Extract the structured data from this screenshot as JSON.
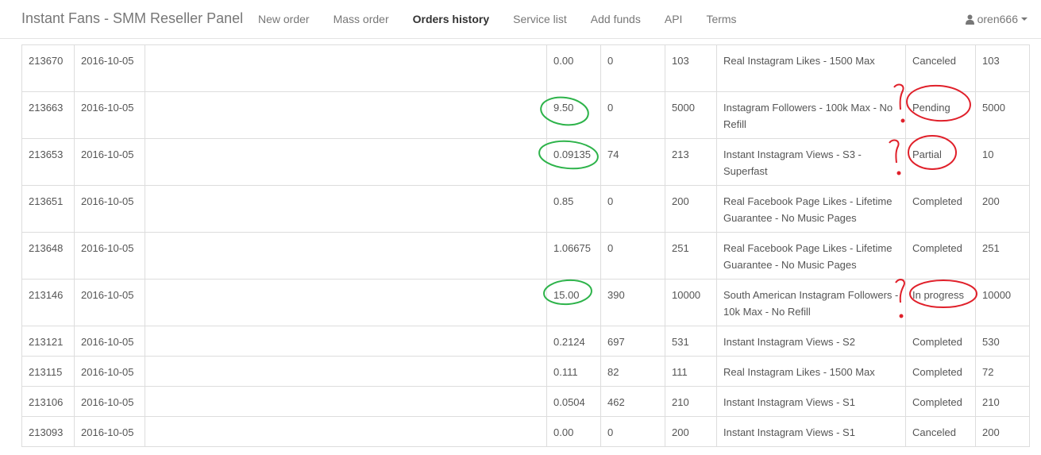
{
  "brand": "Instant Fans - SMM Reseller Panel",
  "nav": {
    "items": [
      "New order",
      "Mass order",
      "Orders history",
      "Service list",
      "Add funds",
      "API",
      "Terms"
    ],
    "active": "Orders history"
  },
  "user": {
    "name": "oren666",
    "icon": "user-icon"
  },
  "orders": [
    {
      "id": "213670",
      "date": "2016-10-05",
      "charge": "0.00",
      "start": "0",
      "quantity": "103",
      "service": "Real Instagram Likes - 1500 Max",
      "status": "Canceled",
      "remains": "103"
    },
    {
      "id": "213663",
      "date": "2016-10-05",
      "charge": "9.50",
      "start": "0",
      "quantity": "5000",
      "service": "Instagram Followers - 100k Max - No Refill",
      "status": "Pending",
      "remains": "5000"
    },
    {
      "id": "213653",
      "date": "2016-10-05",
      "charge": "0.09135",
      "start": "74",
      "quantity": "213",
      "service": "Instant Instagram Views - S3 - Superfast",
      "status": "Partial",
      "remains": "10"
    },
    {
      "id": "213651",
      "date": "2016-10-05",
      "charge": "0.85",
      "start": "0",
      "quantity": "200",
      "service": "Real Facebook Page Likes - Lifetime Guarantee - No Music Pages",
      "status": "Completed",
      "remains": "200"
    },
    {
      "id": "213648",
      "date": "2016-10-05",
      "charge": "1.06675",
      "start": "0",
      "quantity": "251",
      "service": "Real Facebook Page Likes - Lifetime Guarantee - No Music Pages",
      "status": "Completed",
      "remains": "251"
    },
    {
      "id": "213146",
      "date": "2016-10-05",
      "charge": "15.00",
      "start": "390",
      "quantity": "10000",
      "service": "South American Instagram Followers - 10k Max - No Refill",
      "status": "In progress",
      "remains": "10000"
    },
    {
      "id": "213121",
      "date": "2016-10-05",
      "charge": "0.2124",
      "start": "697",
      "quantity": "531",
      "service": "Instant Instagram Views - S2",
      "status": "Completed",
      "remains": "530"
    },
    {
      "id": "213115",
      "date": "2016-10-05",
      "charge": "0.111",
      "start": "82",
      "quantity": "111",
      "service": "Real Instagram Likes - 1500 Max",
      "status": "Completed",
      "remains": "72"
    },
    {
      "id": "213106",
      "date": "2016-10-05",
      "charge": "0.0504",
      "start": "462",
      "quantity": "210",
      "service": "Instant Instagram Views - S1",
      "status": "Completed",
      "remains": "210"
    },
    {
      "id": "213093",
      "date": "2016-10-05",
      "charge": "0.00",
      "start": "0",
      "quantity": "200",
      "service": "Instant Instagram Views - S1",
      "status": "Canceled",
      "remains": "200"
    }
  ],
  "annotation_colors": {
    "green": "#2db34a",
    "red": "#e0202a"
  }
}
